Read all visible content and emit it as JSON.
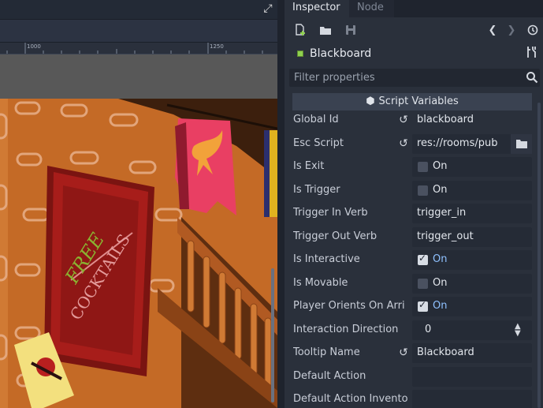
{
  "viewport": {
    "ruler_ticks": [
      "1000",
      "1250"
    ],
    "sign": {
      "line1": "FREE",
      "line2": "COCKTAILS"
    }
  },
  "inspector": {
    "tabs": [
      {
        "label": "Inspector",
        "active": true
      },
      {
        "label": "Node",
        "active": false
      }
    ],
    "toolbar": [
      "new-resource-icon",
      "open-folder-icon",
      "save-icon",
      "back-icon",
      "forward-icon",
      "history-icon"
    ],
    "object": {
      "name": "Blackboard",
      "type_color": "#8fd14f"
    },
    "filter": {
      "placeholder": "Filter properties",
      "value": ""
    },
    "section": {
      "title": "Script Variables"
    },
    "properties": [
      {
        "label": "Global Id",
        "kind": "text",
        "value": "blackboard",
        "revert": true
      },
      {
        "label": "Esc Script",
        "kind": "file",
        "value": "res://rooms/pub",
        "revert": true
      },
      {
        "label": "Is Exit",
        "kind": "check",
        "checked": false,
        "value": "On"
      },
      {
        "label": "Is Trigger",
        "kind": "check",
        "checked": false,
        "value": "On"
      },
      {
        "label": "Trigger In Verb",
        "kind": "text",
        "value": "trigger_in"
      },
      {
        "label": "Trigger Out Verb",
        "kind": "text",
        "value": "trigger_out"
      },
      {
        "label": "Is Interactive",
        "kind": "check",
        "checked": true,
        "value": "On"
      },
      {
        "label": "Is Movable",
        "kind": "check",
        "checked": false,
        "value": "On"
      },
      {
        "label": "Player Orients On Arri",
        "kind": "check",
        "checked": true,
        "value": "On"
      },
      {
        "label": "Interaction Direction",
        "kind": "number",
        "value": "0"
      },
      {
        "label": "Tooltip Name",
        "kind": "text",
        "value": "Blackboard",
        "revert": true
      },
      {
        "label": "Default Action",
        "kind": "text",
        "value": ""
      },
      {
        "label": "Default Action Invento",
        "kind": "text",
        "value": ""
      }
    ]
  }
}
